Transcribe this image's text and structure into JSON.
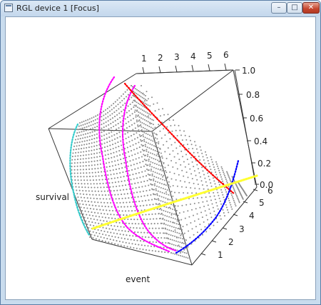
{
  "window": {
    "title": "RGL device 1 [Focus]",
    "controls": {
      "minimize": "–",
      "maximize": "□",
      "close": "✕"
    }
  },
  "plot": {
    "type": "3d-surface-points",
    "axes": {
      "x_label": "event",
      "y_label": "survival",
      "top_ticks": [
        "1",
        "2",
        "3",
        "4",
        "5",
        "6"
      ],
      "right_ticks_z": [
        "1.0",
        "0.8",
        "0.6",
        "0.4",
        "0.2",
        "0.0"
      ],
      "right_ticks_event": [
        "1",
        "2",
        "3",
        "4",
        "5",
        "6"
      ]
    },
    "colors": {
      "points": "#8c8c8c",
      "box": "#333333",
      "cyan": "#33cccc",
      "magenta": "#ff00ff",
      "red": "#ff0000",
      "blue": "#0000ff",
      "yellow": "#ffff33"
    }
  }
}
